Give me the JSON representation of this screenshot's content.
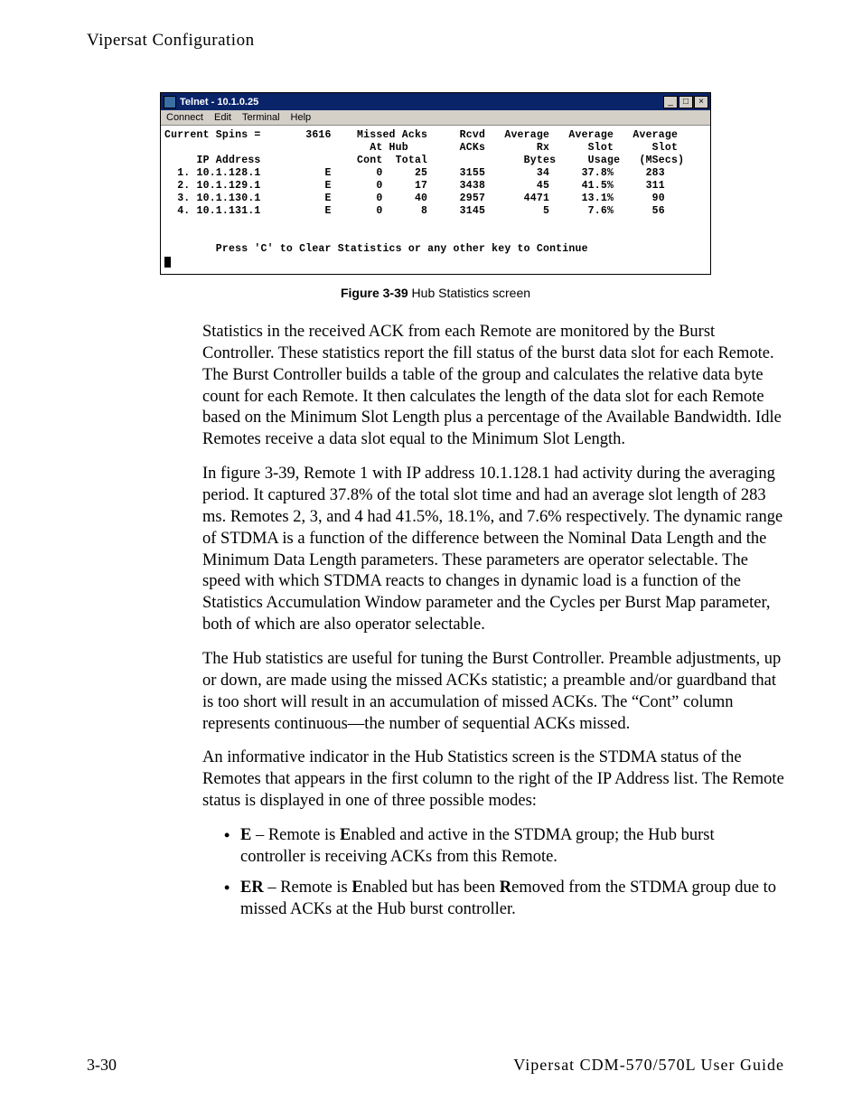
{
  "header": {
    "section": "Vipersat Configuration"
  },
  "telnet": {
    "title": "Telnet - 10.1.0.25",
    "menu": [
      "Connect",
      "Edit",
      "Terminal",
      "Help"
    ],
    "winbtns": {
      "min": "_",
      "max": "□",
      "close": "×"
    },
    "line_spins": "Current Spins =       3616    Missed Acks     Rcvd   Average   Average   Average",
    "line_hdr2": "                                At Hub        ACKs        Rx      Slot      Slot",
    "line_hdr3": "     IP Address               Cont  Total               Bytes     Usage   (MSecs)",
    "row1": "  1. 10.1.128.1          E       0     25     3155        34     37.8%     283",
    "row2": "  2. 10.1.129.1          E       0     17     3438        45     41.5%     311",
    "row3": "  3. 10.1.130.1          E       0     40     2957      4471     13.1%      90",
    "row4": "  4. 10.1.131.1          E       0      8     3145         5      7.6%      56",
    "prompt": "        Press 'C' to Clear Statistics or any other key to Continue"
  },
  "figure": {
    "number": "Figure 3-39",
    "caption": "  Hub Statistics screen"
  },
  "paragraphs": {
    "p1": "Statistics in the received ACK from each Remote are monitored by the Burst Controller. These statistics report the fill status of the burst data slot for each Remote. The Burst Controller builds a table of the group and calculates the relative data byte count for each Remote. It then calculates the length of the data slot for each Remote based on the Minimum Slot Length plus a percentage of the Available Bandwidth. Idle Remotes receive a data slot equal to the Minimum Slot Length.",
    "p2": "In figure 3-39, Remote 1 with IP address 10.1.128.1 had activity during the averaging period. It captured 37.8% of the total slot time and had an average slot length of 283 ms. Remotes 2, 3, and 4 had 41.5%, 18.1%, and 7.6% respectively. The dynamic range of STDMA is a function of the difference between the Nominal Data Length and the Minimum Data Length parameters. These parameters are operator selectable. The speed with which STDMA reacts to changes in dynamic load is a function of the Statistics Accumulation Window parameter and the Cycles per Burst Map parameter, both of which are also operator selectable.",
    "p3": "The Hub statistics are useful for tuning the Burst Controller. Preamble adjustments, up or down, are made using the missed ACKs statistic; a preamble and/or guardband that is too short will result in an accumulation of missed ACKs. The “Cont” column represents continuous—the number of sequential ACKs missed.",
    "p4": "An informative indicator in the Hub Statistics screen is the STDMA status of the Remotes that appears in the first column to the right of the IP Address list. The Remote status is displayed in one of three possible modes:"
  },
  "list": {
    "e_code": "E",
    "e_dash": " – Remote is ",
    "e_bold": "E",
    "e_rest": "nabled and active in the STDMA group; the Hub burst controller is receiving ACKs from this Remote.",
    "er_code": "ER",
    "er_dash": " – Remote is ",
    "er_bold1": "E",
    "er_mid": "nabled but has been ",
    "er_bold2": "R",
    "er_rest": "emoved from the STDMA group due to missed ACKs at the Hub burst controller."
  },
  "footer": {
    "page": "3-30",
    "guide": "Vipersat CDM-570/570L User Guide"
  }
}
